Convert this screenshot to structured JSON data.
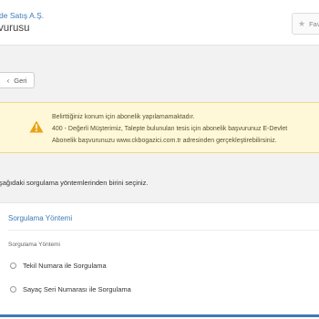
{
  "header": {
    "org_name": "de Satış A.Ş.",
    "service_name": "vurusu",
    "favorite_label": "Fav"
  },
  "back_button": {
    "label": "Geri"
  },
  "alert": {
    "line1": "Belirttiğiniz konum için abonelik yapılamamaktadır.",
    "line2": "400 - Değerli Müşterimiz, Talepte bulunulan tesis için abonelik başvurunuz E-Devlet",
    "line3": "Abonelik başvurunuzu www.ckbogazici.com.tr adresinden gerçekleştirebilirsiniz."
  },
  "instruction": "şağıdaki sorgulama yöntemlerinden birini seçiniz.",
  "query_card": {
    "title": "Sorgulama Yöntemi",
    "field_label": "Sorgulama Yöntemi",
    "options": [
      {
        "label": "Tekil Numara ile Sorgulama"
      },
      {
        "label": "Sayaç Seri Numarası ile Sorgulama"
      }
    ]
  },
  "colors": {
    "accent": "#3d7ab8",
    "alert_bg": "#fff8d8",
    "warning_icon": "#e8a317"
  }
}
